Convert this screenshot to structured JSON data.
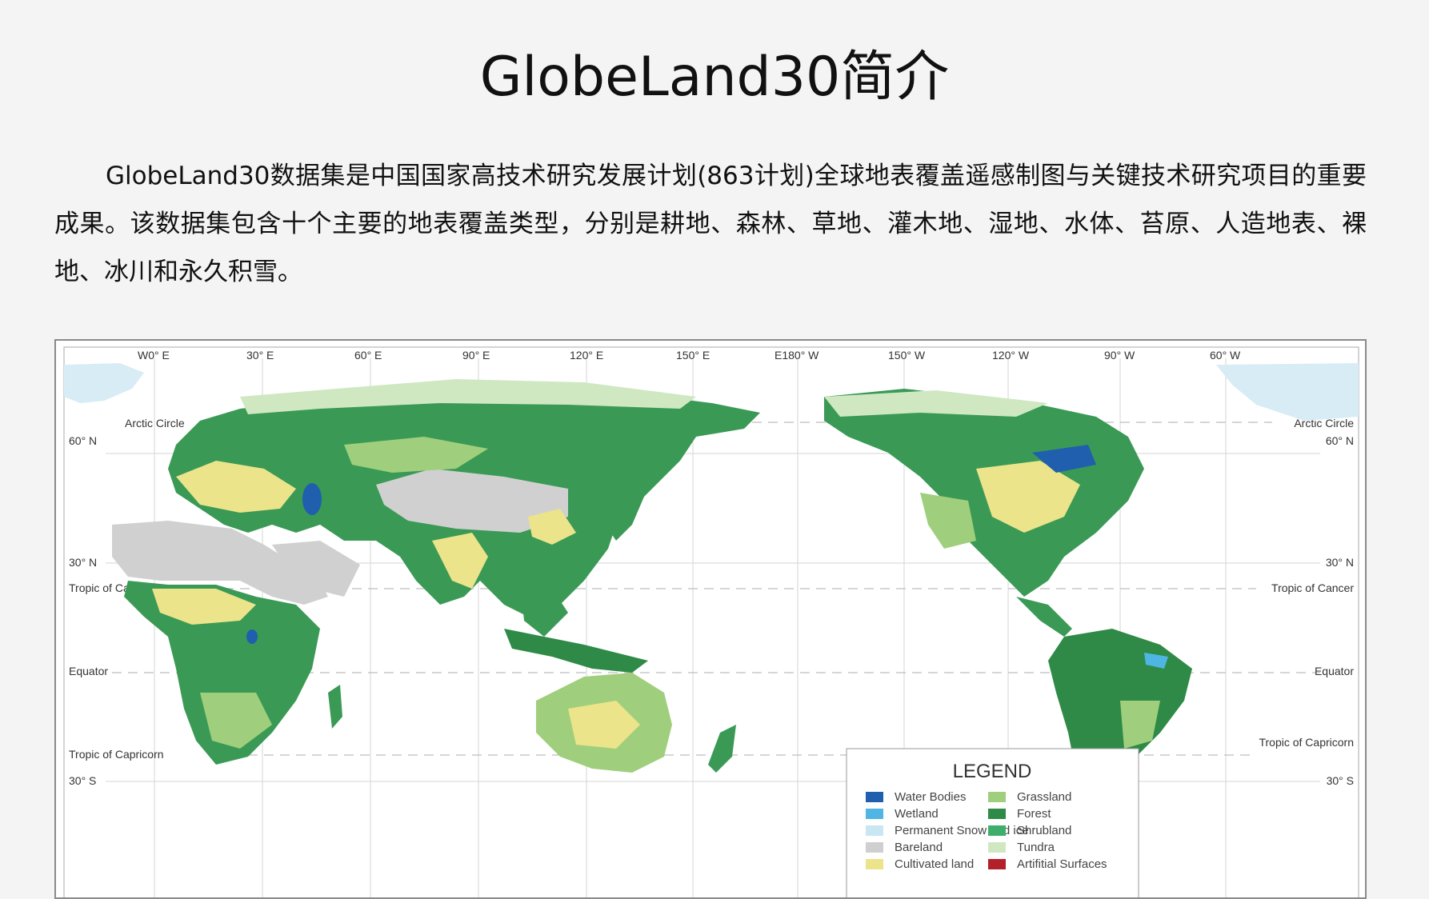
{
  "title": "GlobeLand30简介",
  "intro": "GlobeLand30数据集是中国国家高技术研究发展计划(863计划)全球地表覆盖遥感制图与关键技术研究项目的重要成果。该数据集包含十个主要的地表覆盖类型，分别是耕地、森林、草地、灌木地、湿地、水体、苔原、人造地表、裸地、冰川和永久积雪。",
  "map": {
    "longitude_labels": [
      "W0° E",
      "30° E",
      "60° E",
      "90° E",
      "120° E",
      "150° E",
      "E180° W",
      "150° W",
      "120° W",
      "90° W",
      "60° W"
    ],
    "latitude_labels_left": [
      "60° N",
      "30° N",
      "30° S"
    ],
    "latitude_labels_right": [
      "60° N",
      "30° N",
      "30° S"
    ],
    "parallels_left": [
      "Arctic Circle",
      "Tropic of Cancer",
      "Equator",
      "Tropic of Capricorn"
    ],
    "parallels_right": [
      "Arctic Circle",
      "Tropic of Cancer",
      "Equator",
      "Tropic of Capricorn"
    ],
    "legend": {
      "title": "LEGEND",
      "items": [
        {
          "label": "Water Bodies",
          "color": "#1f5fae"
        },
        {
          "label": "Grassland",
          "color": "#9fcf7c"
        },
        {
          "label": "Wetland",
          "color": "#4fb5e3"
        },
        {
          "label": "Forest",
          "color": "#2e8a46"
        },
        {
          "label": "Permanent Snow and ice",
          "color": "#c9e6f3"
        },
        {
          "label": "Shrubland",
          "color": "#3fae6c"
        },
        {
          "label": "Bareland",
          "color": "#cfcfcf"
        },
        {
          "label": "Tundra",
          "color": "#cfe8c2"
        },
        {
          "label": "Cultivated land",
          "color": "#ece48a"
        },
        {
          "label": "Artifitial Surfaces",
          "color": "#b3202a"
        }
      ]
    },
    "colors": {
      "ocean": "#ffffff",
      "forest": "#2e8a46",
      "grass": "#7fbf6a",
      "crop": "#ece48a",
      "bare": "#d0d0d0",
      "tundra": "#cfe8c2",
      "snow": "#d8ecf5",
      "water": "#1f5fae"
    }
  }
}
